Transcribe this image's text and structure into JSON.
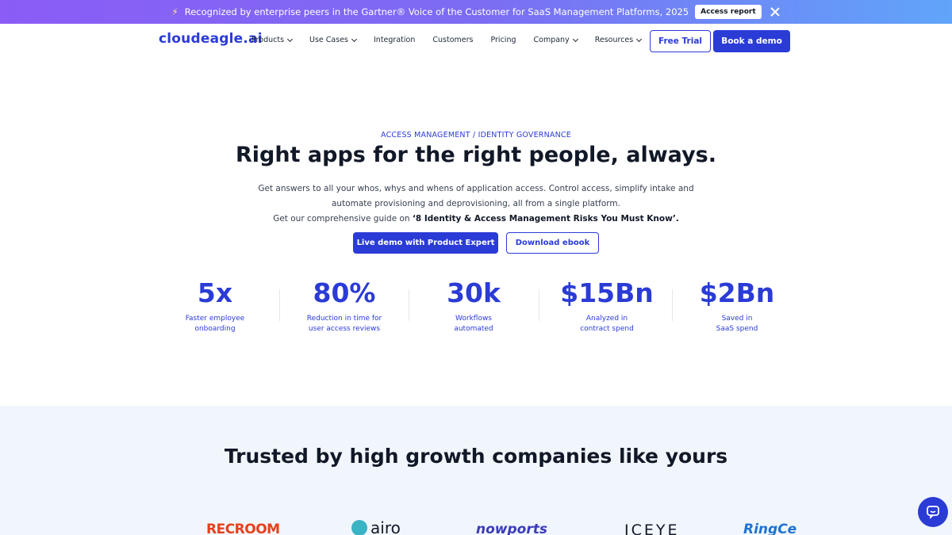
{
  "announcement": {
    "text": "Recognized by enterprise peers in the Gartner® Voice of the Customer for SaaS Management Platforms, 2025",
    "button_label": "Access report"
  },
  "nav": {
    "logo": "cloudeagle.ai",
    "items": [
      {
        "label": "Products",
        "has_dropdown": true
      },
      {
        "label": "Use Cases",
        "has_dropdown": true
      },
      {
        "label": "Integration",
        "has_dropdown": false
      },
      {
        "label": "Customers",
        "has_dropdown": false
      },
      {
        "label": "Pricing",
        "has_dropdown": false
      },
      {
        "label": "Company",
        "has_dropdown": true
      },
      {
        "label": "Resources",
        "has_dropdown": true
      }
    ],
    "free_trial": "Free Trial",
    "book_demo": "Book a demo"
  },
  "hero": {
    "eyebrow": "ACCESS MANAGEMENT / IDENTITY GOVERNANCE",
    "title": "Right apps for the right people, always.",
    "desc_line1": "Get answers to all your whos, whys and whens of application access. Control access, simplify intake and",
    "desc_line2": "automate provisioning and deprovisioning, all from a single platform.",
    "desc_line3_prefix": "Get our comprehensive guide on ",
    "desc_line3_bold": "‘8 Identity & Access Management Risks You Must Know’.",
    "cta_primary": "Live demo with Product Expert",
    "cta_secondary": "Download ebook"
  },
  "stats": [
    {
      "value": "5x",
      "label1": "Faster employee",
      "label2": "onboarding"
    },
    {
      "value": "80%",
      "label1": "Reduction in time for",
      "label2": "user access reviews"
    },
    {
      "value": "30k",
      "label1": "Workflows",
      "label2": "automated"
    },
    {
      "value": "$15Bn",
      "label1": "Analyzed in",
      "label2": "contract spend"
    },
    {
      "value": "$2Bn",
      "label1": "Saved in",
      "label2": "SaaS spend"
    }
  ],
  "trusted": {
    "title": "Trusted by high growth companies like yours",
    "logos": [
      "RECROOM",
      "airo",
      "nowports",
      "ICEYE",
      "RingCe"
    ]
  },
  "colors": {
    "brand": "#2b3bd6",
    "announce_gradient_start": "#8b5cf6",
    "announce_gradient_end": "#60a5fa",
    "section_bg": "#f1f6fc"
  }
}
